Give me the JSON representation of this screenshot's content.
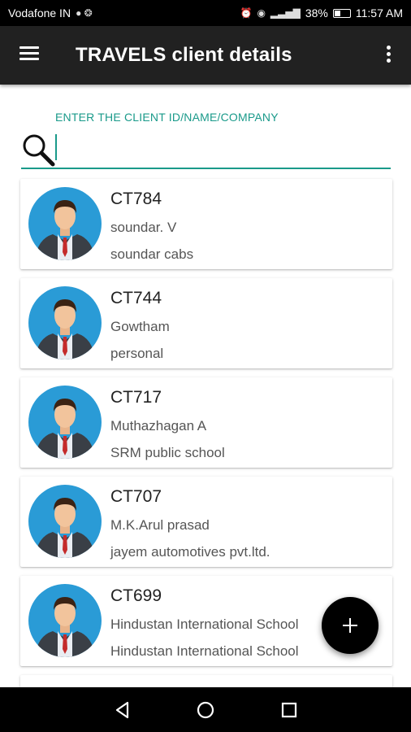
{
  "status_bar": {
    "carrier": "Vodafone IN",
    "battery": "38%",
    "time": "11:57 AM",
    "icons": [
      "alarm-icon",
      "eye-comfort-icon",
      "signal-icon",
      "battery-icon"
    ]
  },
  "app_bar": {
    "title": "TRAVELS client details",
    "menu_icon": "hamburger-icon",
    "overflow_icon": "more-vert-icon"
  },
  "search": {
    "label": "ENTER THE CLIENT ID/NAME/COMPANY",
    "value": "",
    "icon": "search-icon",
    "accent_color": "#1a9a8a"
  },
  "clients": [
    {
      "id": "CT784",
      "name": "soundar. V",
      "company": "soundar cabs"
    },
    {
      "id": "CT744",
      "name": "Gowtham",
      "company": "personal"
    },
    {
      "id": "CT717",
      "name": "Muthazhagan A",
      "company": "SRM public school"
    },
    {
      "id": "CT707",
      "name": "M.K.Arul prasad",
      "company": "jayem automotives pvt.ltd."
    },
    {
      "id": "CT699",
      "name": "Hindustan International School",
      "company": "Hindustan International School"
    }
  ],
  "fab": {
    "icon": "plus-icon"
  },
  "nav_bar": {
    "icons": [
      "back-icon",
      "home-icon",
      "recents-icon"
    ]
  }
}
